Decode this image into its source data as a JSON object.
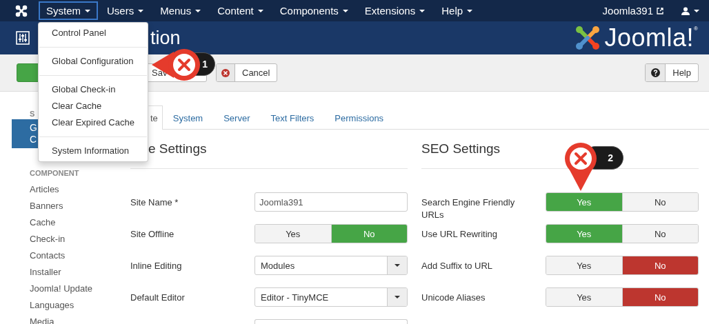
{
  "navbar": {
    "menus": [
      {
        "label": "System",
        "selected": true
      },
      {
        "label": "Users",
        "selected": false
      },
      {
        "label": "Menus",
        "selected": false
      },
      {
        "label": "Content",
        "selected": false
      },
      {
        "label": "Components",
        "selected": false
      },
      {
        "label": "Extensions",
        "selected": false
      },
      {
        "label": "Help",
        "selected": false
      }
    ],
    "site_link": "Joomla391"
  },
  "header": {
    "title": "tion",
    "logo_text": "Joomla!",
    "logo_mark": "®"
  },
  "toolbar": {
    "buttons": [
      {
        "kind": "save"
      },
      {
        "kind": "save_close",
        "label": "Sav"
      },
      {
        "kind": "cancel",
        "label": "Cancel"
      },
      {
        "kind": "help",
        "label": "Help"
      }
    ]
  },
  "sidebar": {
    "system_heading": "S",
    "system_items": [
      {
        "lines": [
          "G",
          "C"
        ],
        "selected": true
      }
    ],
    "component_heading": "COMPONENT",
    "component_items": [
      {
        "label": "Articles",
        "selected": false
      },
      {
        "label": "Banners",
        "selected": false
      },
      {
        "label": "Cache",
        "selected": false
      },
      {
        "label": "Check-in",
        "selected": false
      },
      {
        "label": "Contacts",
        "selected": false
      },
      {
        "label": "Installer",
        "selected": false
      },
      {
        "label": "Joomla! Update",
        "selected": false
      },
      {
        "label": "Languages",
        "selected": false
      },
      {
        "label": "Media",
        "selected": false
      }
    ]
  },
  "tabs": [
    {
      "label": "te",
      "selected": true
    },
    {
      "label": "System",
      "selected": false
    },
    {
      "label": "Server",
      "selected": false
    },
    {
      "label": "Text Filters",
      "selected": false
    },
    {
      "label": "Permissions",
      "selected": false
    }
  ],
  "site_settings": {
    "title": "e Settings",
    "fields": [
      {
        "kind": "text",
        "label": "Site Name *",
        "value": "Joomla391"
      },
      {
        "kind": "toggle",
        "label": "Site Offline",
        "color": "#46a546",
        "options": [
          {
            "label": "Yes",
            "selected": false
          },
          {
            "label": "No",
            "selected": true
          }
        ]
      },
      {
        "kind": "select",
        "label": "Inline Editing",
        "value": "Modules"
      },
      {
        "kind": "select",
        "label": "Default Editor",
        "value": "Editor - TinyMCE"
      },
      {
        "kind": "select_partial"
      }
    ]
  },
  "seo_settings": {
    "title": "SEO Settings",
    "fields": [
      {
        "kind": "toggle",
        "label": "Search Engine Friendly URLs",
        "color": "#46a546",
        "options": [
          {
            "label": "Yes",
            "selected": true
          },
          {
            "label": "No",
            "selected": false
          }
        ]
      },
      {
        "kind": "toggle",
        "label": "Use URL Rewriting",
        "color": "#46a546",
        "options": [
          {
            "label": "Yes",
            "selected": true
          },
          {
            "label": "No",
            "selected": false
          }
        ]
      },
      {
        "kind": "toggle",
        "label": "Add Suffix to URL",
        "color": "#bd362f",
        "options": [
          {
            "label": "Yes",
            "selected": false
          },
          {
            "label": "No",
            "selected": true
          }
        ]
      },
      {
        "kind": "toggle",
        "label": "Unicode Aliases",
        "color": "#bd362f",
        "options": [
          {
            "label": "Yes",
            "selected": false
          },
          {
            "label": "No",
            "selected": true
          }
        ]
      }
    ]
  },
  "system_menu": {
    "groups": [
      [
        "Control Panel"
      ],
      [
        "Global Configuration"
      ],
      [
        "Global Check-in",
        "Clear Cache",
        "Clear Expired Cache"
      ],
      [
        "System Information"
      ]
    ]
  },
  "callouts": [
    {
      "number": "1"
    },
    {
      "number": "2"
    }
  ]
}
